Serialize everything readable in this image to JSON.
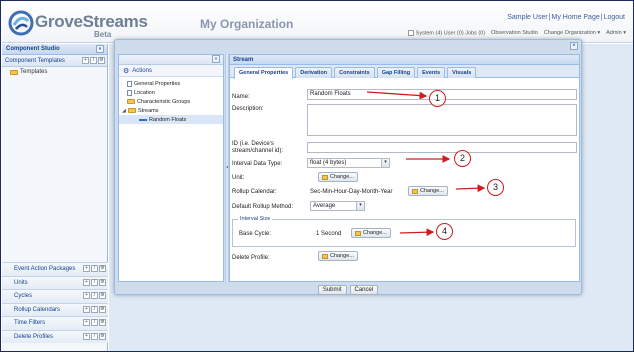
{
  "header": {
    "logo_text": "GroveStreams",
    "logo_sub": "Beta",
    "org_title": "My Organization",
    "links": [
      "Sample User",
      "My Home Page",
      "Logout"
    ],
    "menu": {
      "system_label": "System (4) User (0) Jobs (0)",
      "observation_studio": "Observation Studio",
      "change_org": "Change Organization ▾",
      "admin": "Admin ▾"
    }
  },
  "left_panel": {
    "title": "Component Studio",
    "templates_header": "Component Templates",
    "templates_item": "Templates",
    "list": [
      "Event Action Packages",
      "Units",
      "Cycles",
      "Rollup Calendars",
      "Time Filters",
      "Delete Profiles"
    ]
  },
  "actions": {
    "title": "Actions",
    "tree": [
      {
        "label": "General Properties",
        "type": "doc"
      },
      {
        "label": "Location",
        "type": "doc"
      },
      {
        "label": "Characteristic Groups",
        "type": "folder"
      },
      {
        "label": "Streams",
        "type": "folder"
      },
      {
        "label": "Random Floats",
        "type": "stream"
      }
    ]
  },
  "stream": {
    "title": "Stream",
    "tabs": [
      "General Properties",
      "Derivation",
      "Constraints",
      "Gap Filling",
      "Events",
      "Visuals"
    ],
    "fields": {
      "name_label": "Name:",
      "name_value": "Random Floats",
      "description_label": "Description:",
      "id_label_1": "ID (i.e. Device's",
      "id_label_2": "stream/channel id):",
      "interval_type_label": "Interval Data Type:",
      "interval_type_value": "float (4 bytes)",
      "unit_label": "Unit:",
      "rollup_calendar_label": "Rollup Calendar:",
      "rollup_calendar_value": "Sec-Min-Hour-Day-Month-Year",
      "rollup_method_label": "Default Rollup Method:",
      "rollup_method_value": "Average",
      "interval_size_legend": "Interval Size",
      "base_cycle_label": "Base Cycle:",
      "base_cycle_value": "1 Second",
      "delete_profile_label": "Delete Profile:",
      "change_label": "Change..."
    }
  },
  "annotations": [
    "1",
    "2",
    "3",
    "4"
  ],
  "footer": {
    "submit": "Submit",
    "cancel": "Cancel"
  },
  "colors": {
    "accent": "#15428b",
    "annotation": "#cc1e1e",
    "panel_border": "#99bbe8"
  }
}
